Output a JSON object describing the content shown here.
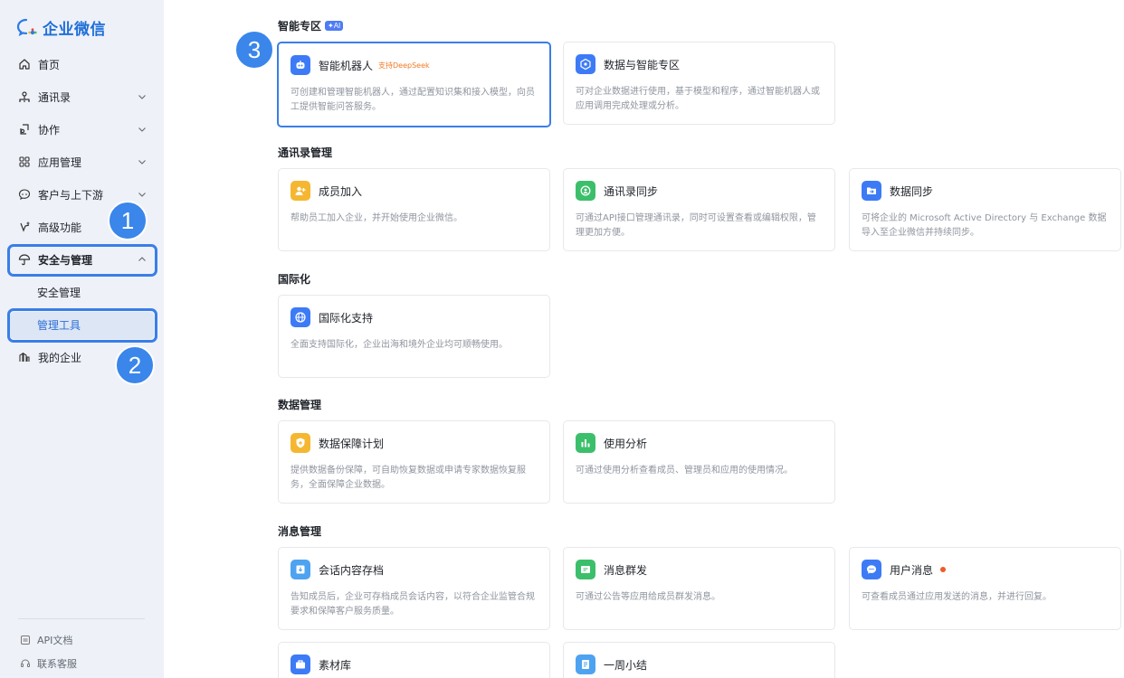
{
  "brand": {
    "name": "企业微信"
  },
  "sidebar": {
    "items": [
      {
        "label": "首页",
        "icon": "home-icon"
      },
      {
        "label": "通讯录",
        "icon": "contacts-icon"
      },
      {
        "label": "协作",
        "icon": "collab-icon"
      },
      {
        "label": "应用管理",
        "icon": "apps-icon"
      },
      {
        "label": "客户与上下游",
        "icon": "customer-icon"
      },
      {
        "label": "高级功能",
        "icon": "advanced-icon"
      },
      {
        "label": "安全与管理",
        "icon": "umbrella-icon"
      },
      {
        "label": "安全管理"
      },
      {
        "label": "管理工具"
      },
      {
        "label": "我的企业",
        "icon": "enterprise-icon"
      }
    ],
    "bottom": [
      {
        "label": "API文档",
        "icon": "doc-icon"
      },
      {
        "label": "联系客服",
        "icon": "headset-icon"
      }
    ]
  },
  "annotations": [
    "1",
    "2",
    "3"
  ],
  "sections": [
    {
      "title": "智能专区",
      "tag": "AI",
      "cards": [
        {
          "title": "智能机器人",
          "tag": "支持DeepSeek",
          "desc": "可创建和管理智能机器人，通过配置知识集和接入模型，向员工提供智能问答服务。",
          "icon": "robot-icon",
          "color": "#3d7bf6"
        },
        {
          "title": "数据与智能专区",
          "desc": "可对企业数据进行使用，基于模型和程序，通过智能机器人或应用调用完成处理或分析。",
          "icon": "data-zone-icon",
          "color": "#3d7bf6"
        }
      ]
    },
    {
      "title": "通讯录管理",
      "cards": [
        {
          "title": "成员加入",
          "desc": "帮助员工加入企业，并开始使用企业微信。",
          "icon": "member-join-icon",
          "color": "#f5b731"
        },
        {
          "title": "通讯录同步",
          "desc": "可通过API接口管理通讯录，同时可设置查看或编辑权限，管理更加方便。",
          "icon": "sync-icon",
          "color": "#3cbf6b"
        },
        {
          "title": "数据同步",
          "desc": "可将企业的 Microsoft Active Directory 与 Exchange 数据导入至企业微信并持续同步。",
          "icon": "folder-icon",
          "color": "#3d7bf6"
        }
      ]
    },
    {
      "title": "国际化",
      "cards": [
        {
          "title": "国际化支持",
          "desc": "全面支持国际化，企业出海和境外企业均可顺畅使用。",
          "icon": "globe-icon",
          "color": "#3d7bf6"
        }
      ]
    },
    {
      "title": "数据管理",
      "cards": [
        {
          "title": "数据保障计划",
          "desc": "提供数据备份保障，可自助恢复数据或申请专家数据恢复服务，全面保障企业数据。",
          "icon": "shield-icon",
          "color": "#f5b731"
        },
        {
          "title": "使用分析",
          "desc": "可通过使用分析查看成员、管理员和应用的使用情况。",
          "icon": "analytics-icon",
          "color": "#3cbf6b"
        }
      ]
    },
    {
      "title": "消息管理",
      "cards": [
        {
          "title": "会话内容存档",
          "desc": "告知成员后，企业可存档成员会话内容，以符合企业监管合规要求和保障客户服务质量。",
          "icon": "archive-icon",
          "color": "#4da3f0"
        },
        {
          "title": "消息群发",
          "desc": "可通过公告等应用给成员群发消息。",
          "icon": "broadcast-icon",
          "color": "#3cbf6b"
        },
        {
          "title": "用户消息",
          "desc": "可查看成员通过应用发送的消息，并进行回复。",
          "icon": "chat-icon",
          "color": "#3d7bf6",
          "dot": "#f05a28"
        },
        {
          "title": "素材库",
          "icon": "material-icon",
          "color": "#3d7bf6"
        },
        {
          "title": "一周小结",
          "icon": "weekly-icon",
          "color": "#4da3f0"
        }
      ]
    }
  ]
}
